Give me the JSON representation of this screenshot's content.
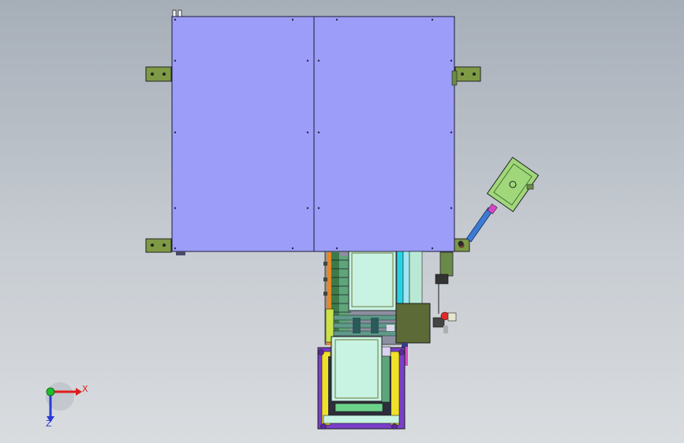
{
  "triad": {
    "x_label": "X",
    "z_label": "Z",
    "x_color": "#e01b1b",
    "z_color": "#2a3ad8",
    "y_color": "#1bbf2a"
  },
  "colors": {
    "cover_fill": "#9b9df8",
    "bracket_fill": "#7e9a45",
    "motor_fill": "#9fd77a",
    "conveyor_fill": "#c8f2e2",
    "yellow_frame": "#f0e02a",
    "purple_frame": "#7a3fc8",
    "cyan_rail": "#28d2e6",
    "olive_box": "#5b6a36",
    "rod_blue": "#3a7bd5"
  },
  "parts": {
    "cover_panels": [
      "left-panel",
      "right-panel"
    ],
    "mount_brackets": [
      "bracket-top-left",
      "bracket-top-right",
      "bracket-bottom-left",
      "bracket-bottom-right"
    ],
    "cylinder": "cylinder-assembly",
    "conveyor": "roller-conveyor",
    "lower_station": "lower-frame-station"
  }
}
